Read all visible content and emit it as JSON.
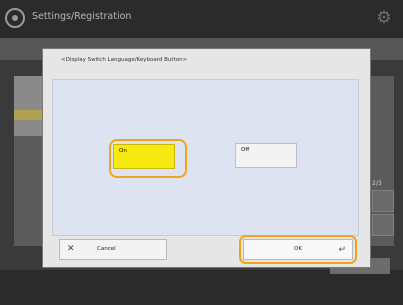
{
  "app": {
    "title": "Settings/Registration",
    "settings_icon": "gear-icon"
  },
  "pager": {
    "label": "2/3"
  },
  "dialog": {
    "title": "<Display Switch Language/Keyboard Button>",
    "options": [
      {
        "label": "On",
        "selected": true
      },
      {
        "label": "Off",
        "selected": false
      }
    ],
    "cancel_label": "Cancel",
    "ok_label": "OK"
  },
  "colors": {
    "selected": "#f7ea13",
    "highlight_ring": "#f0a31b",
    "content_bg": "#dde3f1"
  }
}
